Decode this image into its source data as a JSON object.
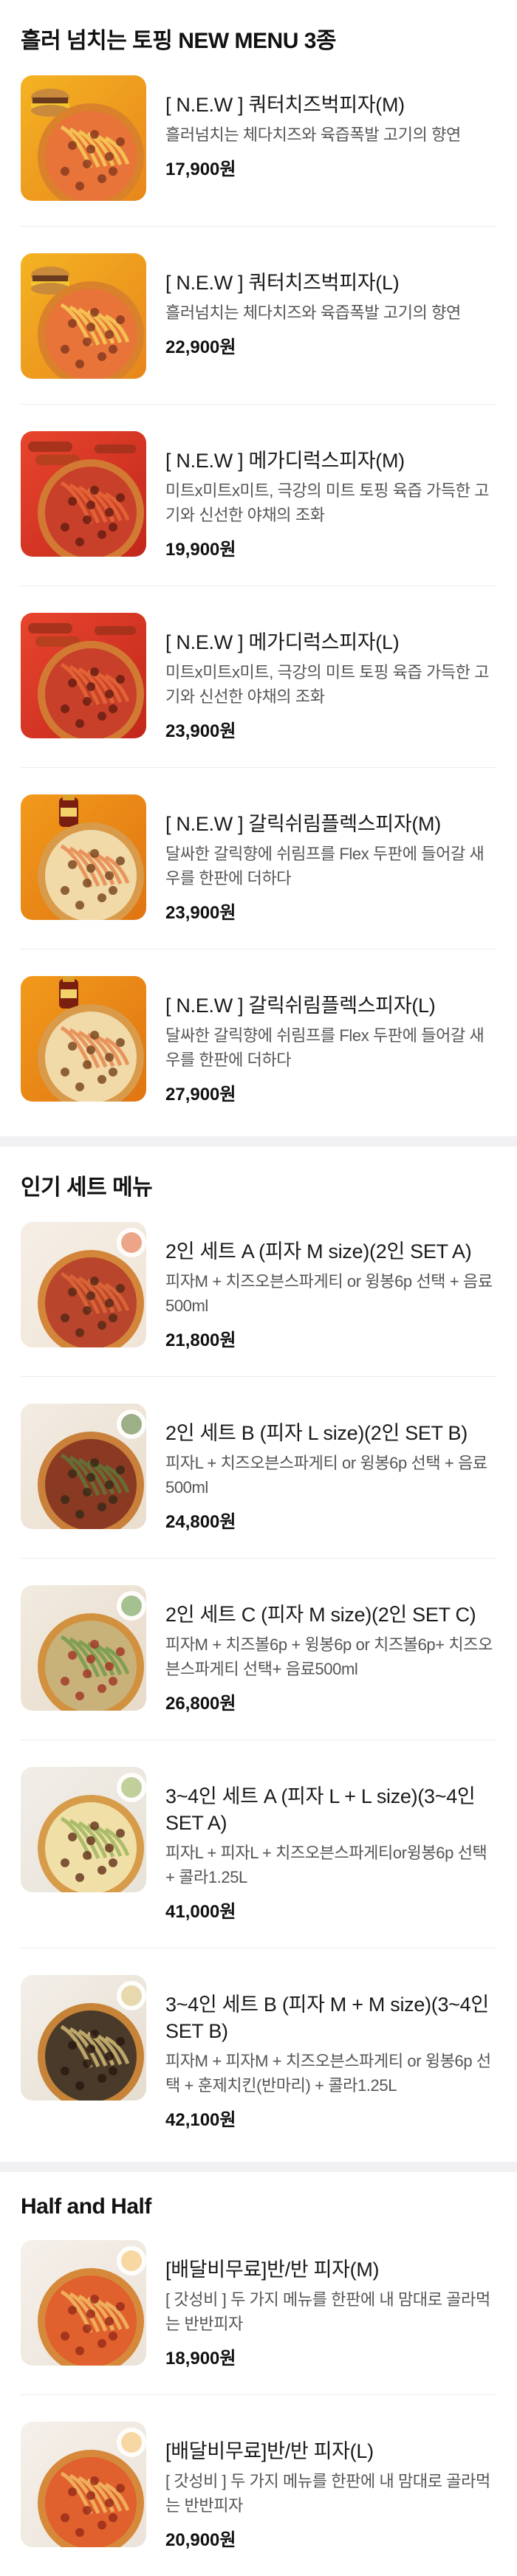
{
  "sections": [
    {
      "title": "흘러 넘치는 토핑 NEW MENU 3종",
      "items": [
        {
          "name": "[ N.E.W ] 쿼터치즈벅피자(M)",
          "desc": "흘러넘치는 체다치즈와 육즙폭발 고기의 향연",
          "price": "17,900원",
          "image": "quarter-cheese-burger-pizza-image"
        },
        {
          "name": "[ N.E.W ] 쿼터치즈벅피자(L)",
          "desc": "흘러넘치는 체다치즈와 육즙폭발 고기의 향연",
          "price": "22,900원",
          "image": "quarter-cheese-burger-pizza-image"
        },
        {
          "name": "[ N.E.W ] 메가디럭스피자(M)",
          "desc": "미트x미트x미트, 극강의 미트 토핑 육즙 가득한 고기와 신선한 야채의 조화",
          "price": "19,900원",
          "image": "mega-deluxe-pizza-image"
        },
        {
          "name": "[ N.E.W ] 메가디럭스피자(L)",
          "desc": "미트x미트x미트, 극강의 미트 토핑 육즙 가득한 고기와 신선한 야채의 조화",
          "price": "23,900원",
          "image": "mega-deluxe-pizza-image"
        },
        {
          "name": "[ N.E.W ] 갈릭쉬림플렉스피자(M)",
          "desc": "달싸한 갈릭향에 쉬림프를 Flex 두판에 들어갈 새우를 한판에 더하다",
          "price": "23,900원",
          "image": "garlic-shrimp-flex-pizza-image"
        },
        {
          "name": "[ N.E.W ] 갈릭쉬림플렉스피자(L)",
          "desc": "달싸한 갈릭향에 쉬림프를 Flex 두판에 들어갈 새우를 한판에 더하다",
          "price": "27,900원",
          "image": "garlic-shrimp-flex-pizza-image"
        }
      ]
    },
    {
      "title": "인기 세트 메뉴",
      "items": [
        {
          "name": "2인 세트 A (피자 M size)(2인 SET A)",
          "desc": "피자M + 치즈오븐스파게티 or 윙봉6p 선택 + 음료500ml",
          "price": "21,800원",
          "image": "set-a-2-image"
        },
        {
          "name": "2인 세트 B (피자 L size)(2인 SET B)",
          "desc": "피자L + 치즈오븐스파게티 or 윙봉6p 선택 + 음료500ml",
          "price": "24,800원",
          "image": "set-b-2-image"
        },
        {
          "name": "2인 세트 C (피자 M size)(2인 SET C)",
          "desc": "피자M + 치즈볼6p + 윙봉6p or 치즈볼6p+ 치즈오븐스파게티 선택+ 음료500ml",
          "price": "26,800원",
          "image": "set-c-2-image"
        },
        {
          "name": "3~4인 세트 A (피자 L + L size)(3~4인 SET A)",
          "desc": "피자L + 피자L + 치즈오븐스파게티or윙봉6p 선택 + 콜라1.25L",
          "price": "41,000원",
          "image": "set-a-34-image"
        },
        {
          "name": "3~4인 세트 B (피자 M + M size)(3~4인 SET B)",
          "desc": "피자M + 피자M + 치즈오븐스파게티 or 윙봉6p 선택 + 훈제치킨(반마리) + 콜라1.25L",
          "price": "42,100원",
          "image": "set-b-34-image"
        }
      ]
    },
    {
      "title": "Half and Half",
      "items": [
        {
          "name": "[배달비무료]반/반 피자(M)",
          "desc": "[ 갓성비 ] 두 가지 메뉴를 한판에 내 맘대로 골라먹는 반반피자",
          "price": "18,900원",
          "image": "half-half-pizza-image"
        },
        {
          "name": "[배달비무료]반/반 피자(L)",
          "desc": "[ 갓성비 ] 두 가지 메뉴를 한판에 내 맘대로 골라먹는 반반피자",
          "price": "20,900원",
          "image": "half-half-pizza-image"
        }
      ]
    }
  ]
}
